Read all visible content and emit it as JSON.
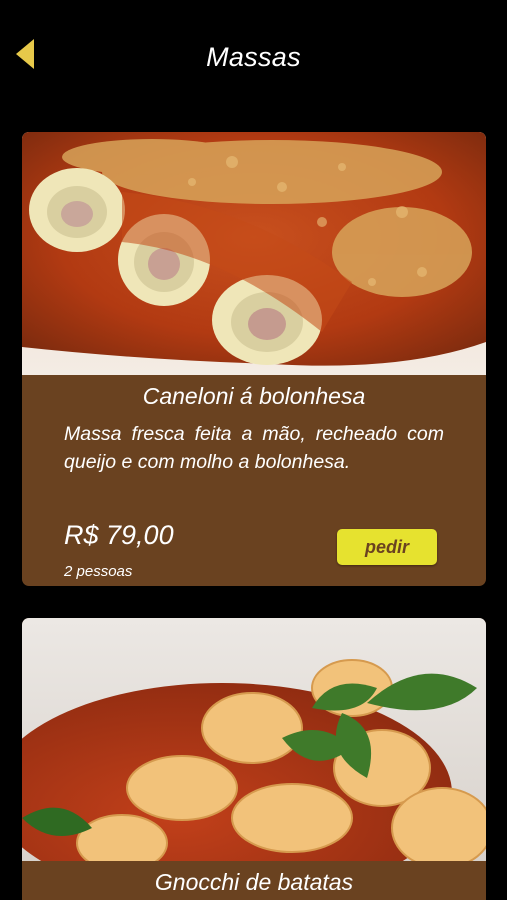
{
  "header": {
    "title": "Massas",
    "back_icon": "back-arrow-icon"
  },
  "colors": {
    "background": "#000000",
    "card": "#6a4220",
    "accent": "#e6e22f"
  },
  "dishes": [
    {
      "name": "Caneloni á bolonhesa",
      "description": "Massa fresca feita a mão, recheado com queijo e com molho a bolonhesa.",
      "price": "R$ 79,00",
      "serves": "2 pessoas",
      "order_label": "pedir"
    },
    {
      "name": "Gnocchi de batatas"
    }
  ]
}
